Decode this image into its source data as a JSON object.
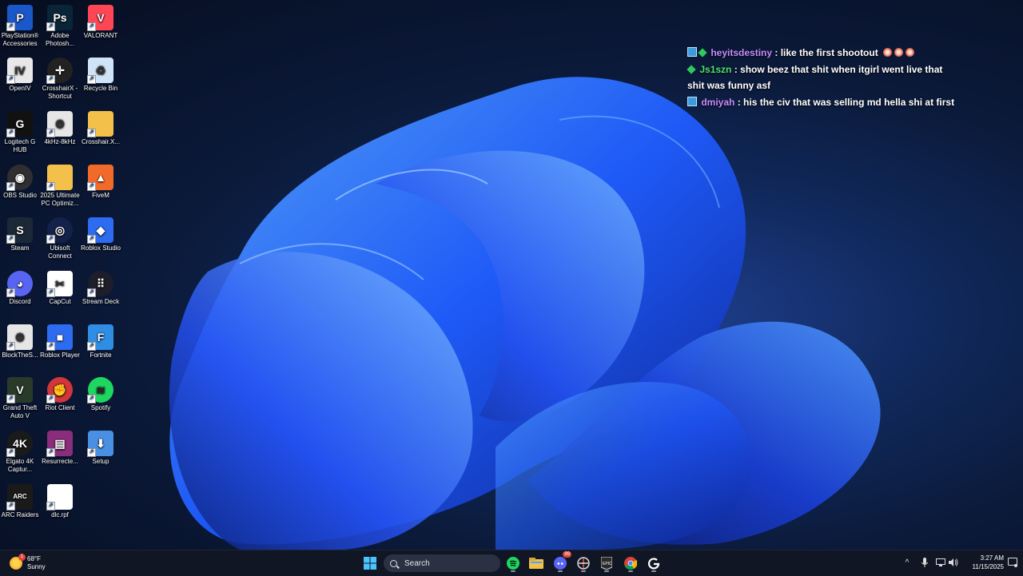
{
  "desktop": {
    "icons": [
      {
        "label": "PlayStation® Accessories",
        "icon": "playstation-icon",
        "color": "#1a57c8"
      },
      {
        "label": "Adobe Photosh...",
        "icon": "photoshop-icon",
        "color": "#0a2438"
      },
      {
        "label": "VALORANT",
        "icon": "valorant-icon",
        "color": "#ff4655"
      },
      {
        "label": "OpenIV",
        "icon": "openiv-icon",
        "color": "#e8e8e8"
      },
      {
        "label": "CrosshairX - Shortcut",
        "icon": "crosshairx-icon",
        "color": "#222222"
      },
      {
        "label": "Recycle Bin",
        "icon": "recycle-bin-icon",
        "color": "#cfe4f6"
      },
      {
        "label": "Logitech G HUB",
        "icon": "logitech-icon",
        "color": "#111111"
      },
      {
        "label": "4kHz-8kHz",
        "icon": "settings-file-icon",
        "color": "#e6e6e6"
      },
      {
        "label": "Crosshair.X...",
        "icon": "folder-icon",
        "color": "#f3c14a"
      },
      {
        "label": "OBS Studio",
        "icon": "obs-icon",
        "color": "#302e31"
      },
      {
        "label": "2025 Ultimate PC Optimiz...",
        "icon": "folder-zip-icon",
        "color": "#f3c14a"
      },
      {
        "label": "FiveM",
        "icon": "fivem-icon",
        "color": "#f26a2a"
      },
      {
        "label": "Steam",
        "icon": "steam-icon",
        "color": "#1b2838"
      },
      {
        "label": "Ubisoft Connect",
        "icon": "ubisoft-icon",
        "color": "#14214a"
      },
      {
        "label": "Roblox Studio",
        "icon": "roblox-studio-icon",
        "color": "#2d6bf0"
      },
      {
        "label": "Discord",
        "icon": "discord-icon",
        "color": "#5865f2"
      },
      {
        "label": "CapCut",
        "icon": "capcut-icon",
        "color": "#ffffff"
      },
      {
        "label": "Stream Deck",
        "icon": "stream-deck-icon",
        "color": "#1e1e2a"
      },
      {
        "label": "BlockTheS...",
        "icon": "settings-file-icon",
        "color": "#e6e6e6"
      },
      {
        "label": "Roblox Player",
        "icon": "roblox-icon",
        "color": "#2d6bf0"
      },
      {
        "label": "Fortnite",
        "icon": "fortnite-icon",
        "color": "#2f8de4"
      },
      {
        "label": "Grand Theft Auto V",
        "icon": "gta-icon",
        "color": "#2a3a2a"
      },
      {
        "label": "Riot Client",
        "icon": "riot-icon",
        "color": "#d13639"
      },
      {
        "label": "Spotify",
        "icon": "spotify-icon",
        "color": "#1ed760"
      },
      {
        "label": "Elgato 4K Captur...",
        "icon": "elgato-icon",
        "color": "#1a1a1a"
      },
      {
        "label": "Resurrecte...",
        "icon": "winrar-icon",
        "color": "#8a2d7a"
      },
      {
        "label": "Setup",
        "icon": "setup-icon",
        "color": "#4a90e2"
      },
      {
        "label": "ARC Raiders",
        "icon": "arc-raiders-icon",
        "color": "#1a1a1a"
      },
      {
        "label": "dlc.rpf",
        "icon": "blank-file-icon",
        "color": "#ffffff"
      }
    ]
  },
  "chat": {
    "messages": [
      {
        "user": "heyitsdestiny",
        "user_color": "#c58cff",
        "badges": [
          "sub-badge",
          "gem-badge"
        ],
        "text": " : like the first shootout",
        "emotes": 3
      },
      {
        "user": "Js1szn",
        "user_color": "#4de06a",
        "badges": [
          "gem-badge"
        ],
        "text": " : show beez that shit when itgirl went live that shit was funny asf",
        "emotes": 0
      },
      {
        "user": "dmiyah",
        "user_color": "#c58cff",
        "badges": [
          "sub-badge"
        ],
        "text": " : his the civ that was selling md hella shi at first",
        "emotes": 0
      }
    ]
  },
  "taskbar": {
    "weather": {
      "temp": "68°F",
      "condition": "Sunny",
      "badge": "1"
    },
    "search_placeholder": "Search",
    "apps": [
      "start-icon",
      "spotify-icon",
      "file-explorer-icon",
      "discord-icon",
      "crosshairx-icon",
      "epic-games-icon",
      "chrome-icon",
      "logitech-icon"
    ],
    "discord_badge": "99",
    "time": "3:27 AM",
    "date": "11/15/2025"
  }
}
